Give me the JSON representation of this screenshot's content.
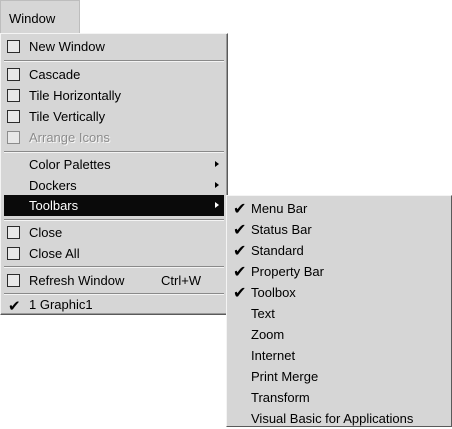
{
  "menubar": {
    "title": "Window"
  },
  "window_menu": {
    "new_window": "New Window",
    "cascade": "Cascade",
    "tile_horizontally": "Tile Horizontally",
    "tile_vertically": "Tile Vertically",
    "arrange_icons": "Arrange Icons",
    "color_palettes": "Color Palettes",
    "dockers": "Dockers",
    "toolbars": "Toolbars",
    "close": "Close",
    "close_all": "Close All",
    "refresh_window": "Refresh Window",
    "refresh_shortcut": "Ctrl+W",
    "graphic1": "1 Graphic1"
  },
  "toolbars_submenu": {
    "items": [
      {
        "label": "Menu Bar",
        "checked": true
      },
      {
        "label": "Status Bar",
        "checked": true
      },
      {
        "label": "Standard",
        "checked": true
      },
      {
        "label": "Property Bar",
        "checked": true
      },
      {
        "label": "Toolbox",
        "checked": true
      },
      {
        "label": "Text",
        "checked": false
      },
      {
        "label": "Zoom",
        "checked": false
      },
      {
        "label": "Internet",
        "checked": false
      },
      {
        "label": "Print Merge",
        "checked": false
      },
      {
        "label": "Transform",
        "checked": false
      },
      {
        "label": "Visual Basic for Applications",
        "checked": false
      }
    ]
  },
  "colors": {
    "menu_bg": "#d6d6d6",
    "selected_bg": "#0a0a0a",
    "disabled_text": "#8c8c8c"
  }
}
